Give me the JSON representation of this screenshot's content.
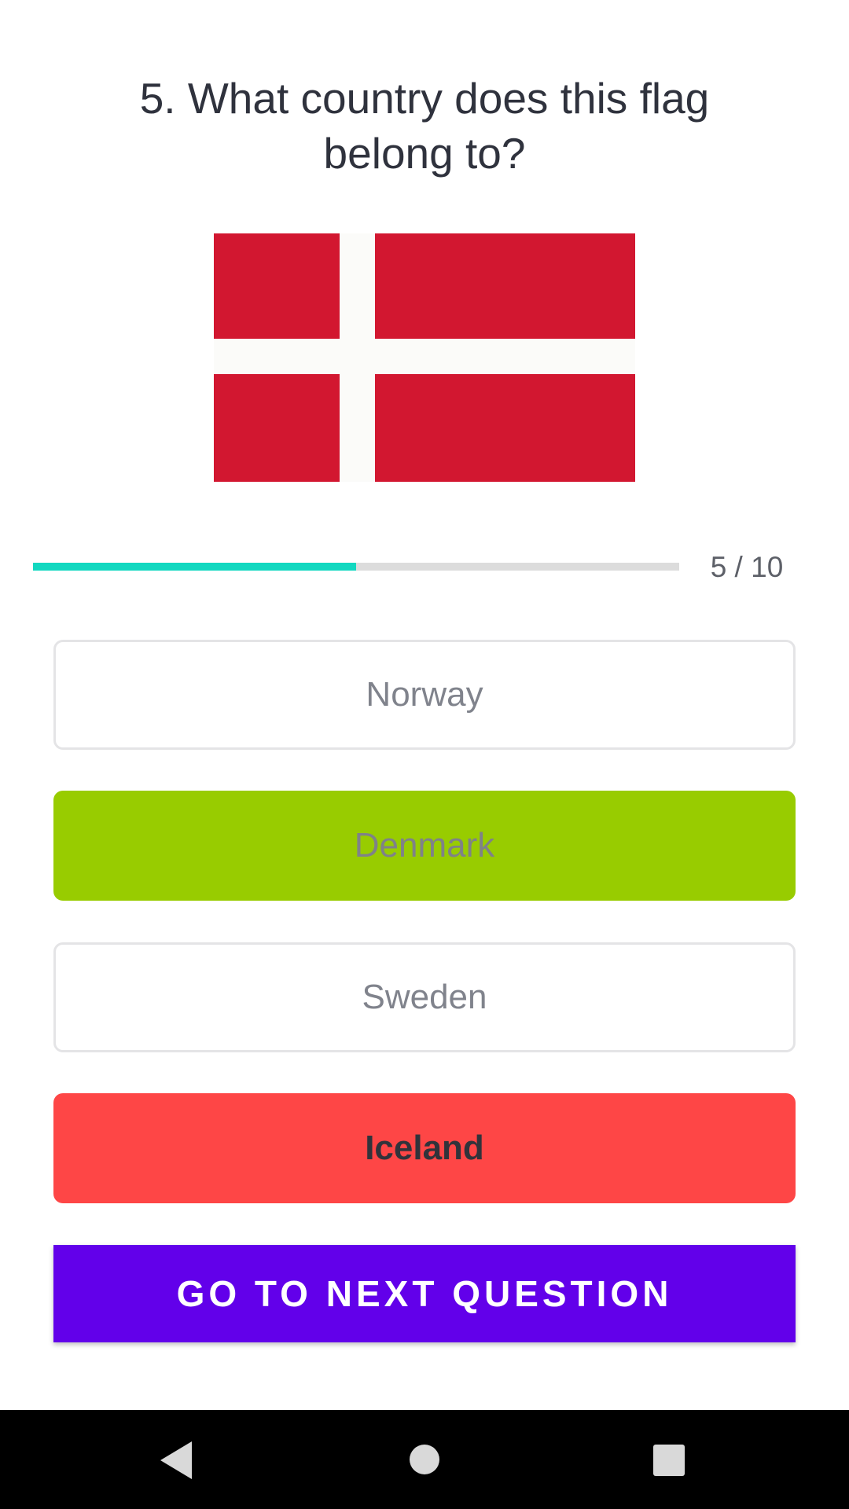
{
  "question": {
    "text": "5. What country does this flag belong to?"
  },
  "flag": {
    "name": "denmark-flag",
    "field_color": "#d21730",
    "cross_color": "#fbfbf9"
  },
  "progress": {
    "current": 5,
    "total": 10,
    "fraction": 0.5,
    "label": "5 / 10",
    "fill_color": "#12d8c0",
    "track_color": "#dcdcdc"
  },
  "options": [
    {
      "label": "Norway",
      "state": "neutral"
    },
    {
      "label": "Denmark",
      "state": "correct"
    },
    {
      "label": "Sweden",
      "state": "neutral"
    },
    {
      "label": "Iceland",
      "state": "wrong"
    }
  ],
  "colors": {
    "correct": "#98cc00",
    "wrong": "#fe4646",
    "primary": "#6200ea"
  },
  "next_button": {
    "label": "GO TO NEXT QUESTION"
  },
  "system_nav": {
    "back_icon": "back-triangle-icon",
    "home_icon": "home-circle-icon",
    "recents_icon": "recents-square-icon"
  }
}
